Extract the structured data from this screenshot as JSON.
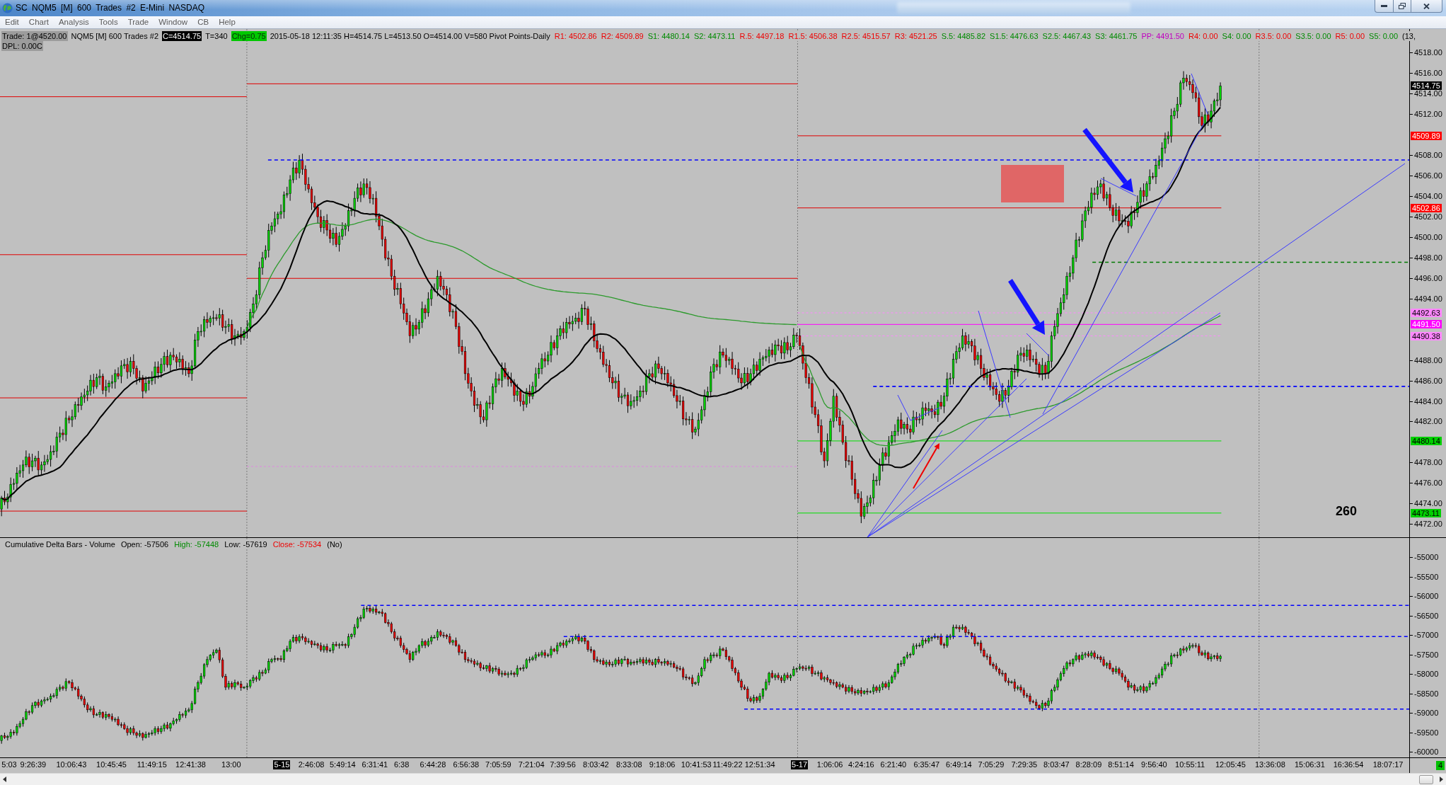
{
  "window": {
    "title": "SC NQM5 [M] 600 Trades #2 E-Mini NASDAQ"
  },
  "menu": [
    "Edit",
    "Chart",
    "Analysis",
    "Tools",
    "Trade",
    "Window",
    "CB",
    "Help"
  ],
  "info_line": {
    "items": [
      {
        "kind": "gray",
        "text": "Trade: 1@4520.00"
      },
      {
        "kind": "plain",
        "text": "NQM5 [M] 600 Trades #2"
      },
      {
        "kind": "dark",
        "text": "C=4514.75"
      },
      {
        "kind": "plain",
        "text": "T=340"
      },
      {
        "kind": "green",
        "text": "Chg=0.75"
      },
      {
        "kind": "plain",
        "text": "2015-05-18 12:11:35 H=4514.75 L=4513.50 O=4514.00 V=580 Pivot Points-Daily"
      },
      {
        "kind": "pivot",
        "text": "R1: 4502.86",
        "color": "#ee0000"
      },
      {
        "kind": "pivot",
        "text": "R2: 4509.89",
        "color": "#ee0000"
      },
      {
        "kind": "pivot",
        "text": "S1: 4480.14",
        "color": "#008a00"
      },
      {
        "kind": "pivot",
        "text": "S2: 4473.11",
        "color": "#008a00"
      },
      {
        "kind": "pivot",
        "text": "R.5: 4497.18",
        "color": "#ee0000"
      },
      {
        "kind": "pivot",
        "text": "R1.5: 4506.38",
        "color": "#ee0000"
      },
      {
        "kind": "pivot",
        "text": "R2.5: 4515.57",
        "color": "#ee0000"
      },
      {
        "kind": "pivot",
        "text": "R3: 4521.25",
        "color": "#ee0000"
      },
      {
        "kind": "pivot",
        "text": "S.5: 4485.82",
        "color": "#008a00"
      },
      {
        "kind": "pivot",
        "text": "S1.5: 4476.63",
        "color": "#008a00"
      },
      {
        "kind": "pivot",
        "text": "S2.5: 4467.43",
        "color": "#008a00"
      },
      {
        "kind": "pivot",
        "text": "S3: 4461.75",
        "color": "#008a00"
      },
      {
        "kind": "pivot",
        "text": "PP: 4491.50",
        "color": "#c000c0"
      },
      {
        "kind": "pivot",
        "text": "R4: 0.00",
        "color": "#ee0000"
      },
      {
        "kind": "pivot",
        "text": "S4: 0.00",
        "color": "#008a00"
      },
      {
        "kind": "pivot",
        "text": "R3.5: 0.00",
        "color": "#ee0000"
      },
      {
        "kind": "pivot",
        "text": "S3.5: 0.00",
        "color": "#008a00"
      },
      {
        "kind": "pivot",
        "text": "R5: 0.00",
        "color": "#ee0000"
      },
      {
        "kind": "pivot",
        "text": "S5: 0.00",
        "color": "#008a00"
      },
      {
        "kind": "plain",
        "text": "(13,"
      }
    ],
    "second_line": "DPL: 0.00C"
  },
  "price_chart": {
    "price_axis": [
      "4518.00",
      "4516.00",
      "4514.00",
      "4512.00",
      "4508.00",
      "4506.00",
      "4504.00",
      "4502.00",
      "4500.00",
      "4498.00",
      "4496.00",
      "4494.00",
      "4488.00",
      "4486.00",
      "4484.00",
      "4482.00",
      "4478.00",
      "4476.00",
      "4474.00",
      "4472.00"
    ],
    "price_tags": [
      {
        "text": "4514.75",
        "color": "#000000"
      },
      {
        "text": "4509.89",
        "color": "#ff0000"
      },
      {
        "text": "4502.86",
        "color": "#ff0000"
      },
      {
        "text": "4492.63",
        "color": "#ff88ff"
      },
      {
        "text": "4491.50",
        "color": "#ff00ff"
      },
      {
        "text": "4490.38",
        "color": "#ff88ff"
      },
      {
        "text": "4480.14",
        "color": "#00d000"
      },
      {
        "text": "4473.11",
        "color": "#00d000"
      }
    ],
    "note": "260"
  },
  "delta_chart": {
    "title": "Cumulative Delta Bars - Volume",
    "values": [
      {
        "text": "Open: -57506"
      },
      {
        "text": "High: -57448",
        "color": "#008a00"
      },
      {
        "text": "Low: -57619"
      },
      {
        "text": "Close: -57534",
        "color": "#ee0000"
      },
      {
        "text": "(No)"
      }
    ],
    "value_axis": [
      "-55000",
      "-55500",
      "-56000",
      "-56500",
      "-57000",
      "-57500",
      "-58000",
      "-58500",
      "-59000",
      "-59500",
      "-60000"
    ]
  },
  "time_axis": [
    {
      "label": "5:03",
      "kind": "time"
    },
    {
      "label": "9:26:39",
      "kind": "time"
    },
    {
      "label": "10:06:43",
      "kind": "time"
    },
    {
      "label": "10:45:45",
      "kind": "time"
    },
    {
      "label": "11:49:15",
      "kind": "time"
    },
    {
      "label": "12:41:38",
      "kind": "time"
    },
    {
      "label": "13:00",
      "kind": "time"
    },
    {
      "label": "5-15",
      "kind": "date"
    },
    {
      "label": "2:46:08",
      "kind": "time"
    },
    {
      "label": "5:49:14",
      "kind": "time"
    },
    {
      "label": "6:31:41",
      "kind": "time"
    },
    {
      "label": "6:38",
      "kind": "time"
    },
    {
      "label": "6:44:28",
      "kind": "time"
    },
    {
      "label": "6:56:38",
      "kind": "time"
    },
    {
      "label": "7:05:59",
      "kind": "time"
    },
    {
      "label": "7:21:04",
      "kind": "time"
    },
    {
      "label": "7:39:56",
      "kind": "time"
    },
    {
      "label": "8:03:42",
      "kind": "time"
    },
    {
      "label": "8:33:08",
      "kind": "time"
    },
    {
      "label": "9:18:06",
      "kind": "time"
    },
    {
      "label": "10:41:53",
      "kind": "time"
    },
    {
      "label": "11:49:22",
      "kind": "time"
    },
    {
      "label": "12:51:34",
      "kind": "time"
    },
    {
      "label": "5-17",
      "kind": "date"
    },
    {
      "label": "1:06:06",
      "kind": "time"
    },
    {
      "label": "4:24:16",
      "kind": "time"
    },
    {
      "label": "6:21:40",
      "kind": "time"
    },
    {
      "label": "6:35:47",
      "kind": "time"
    },
    {
      "label": "6:49:14",
      "kind": "time"
    },
    {
      "label": "7:05:29",
      "kind": "time"
    },
    {
      "label": "7:29:35",
      "kind": "time"
    },
    {
      "label": "8:03:47",
      "kind": "time"
    },
    {
      "label": "8:28:09",
      "kind": "time"
    },
    {
      "label": "8:51:14",
      "kind": "time"
    },
    {
      "label": "9:56:40",
      "kind": "time"
    },
    {
      "label": "10:55:11",
      "kind": "time"
    },
    {
      "label": "12:05:45",
      "kind": "time"
    },
    {
      "label": "13:36:08",
      "kind": "time"
    },
    {
      "label": "15:06:31",
      "kind": "time"
    },
    {
      "label": "16:36:54",
      "kind": "time"
    },
    {
      "label": "18:07:17",
      "kind": "time"
    }
  ],
  "status_indicator": "4"
}
